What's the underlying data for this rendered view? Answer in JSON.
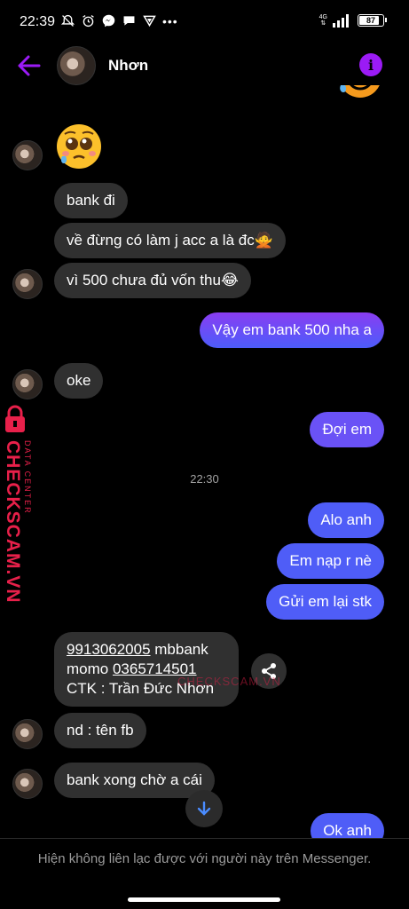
{
  "status_bar": {
    "time": "22:39",
    "network": "4G",
    "battery": "87",
    "battery_level": 0.87
  },
  "header": {
    "contact_name": "Nhơn"
  },
  "messages": [
    {
      "side": "in",
      "text": "bank đi"
    },
    {
      "side": "in",
      "text": "về đừng có làm j acc a là đc🙅"
    },
    {
      "side": "in",
      "text": "vì 500 chưa đủ vốn thu😂"
    },
    {
      "side": "out",
      "text": "Vậy em bank 500 nha a"
    },
    {
      "side": "in",
      "text": "oke"
    },
    {
      "side": "out",
      "text": "Đợi em"
    },
    {
      "side": "out",
      "text": "Alo anh"
    },
    {
      "side": "out",
      "text": "Em nạp r nè"
    },
    {
      "side": "out",
      "text": "Gửi em lại stk"
    },
    {
      "side": "in",
      "text": "nd : tên fb"
    },
    {
      "side": "in",
      "text": "bank xong chờ a cái"
    },
    {
      "side": "out",
      "text": "Ok anh"
    }
  ],
  "bank_message": {
    "account_number": "9913062005",
    "bank": " mbbank",
    "momo_label": "momo ",
    "momo_number": "0365714501",
    "holder": "CTK : Trần Đức Nhơn"
  },
  "timestamp": "22:30",
  "watermark": {
    "brand": "CHECKSCAM.VN",
    "sub": "DATA CENTER",
    "inline": "CHECKSCAM.VN"
  },
  "footer": {
    "notice": "Hiện không liên lạc được với người này trên Messenger."
  },
  "colors": {
    "accent": "#9b1bf5",
    "outgoing_top": "#8a3cf0",
    "outgoing_bottom": "#4d5cf8",
    "incoming": "#303030",
    "watermark": "#e8204a"
  }
}
